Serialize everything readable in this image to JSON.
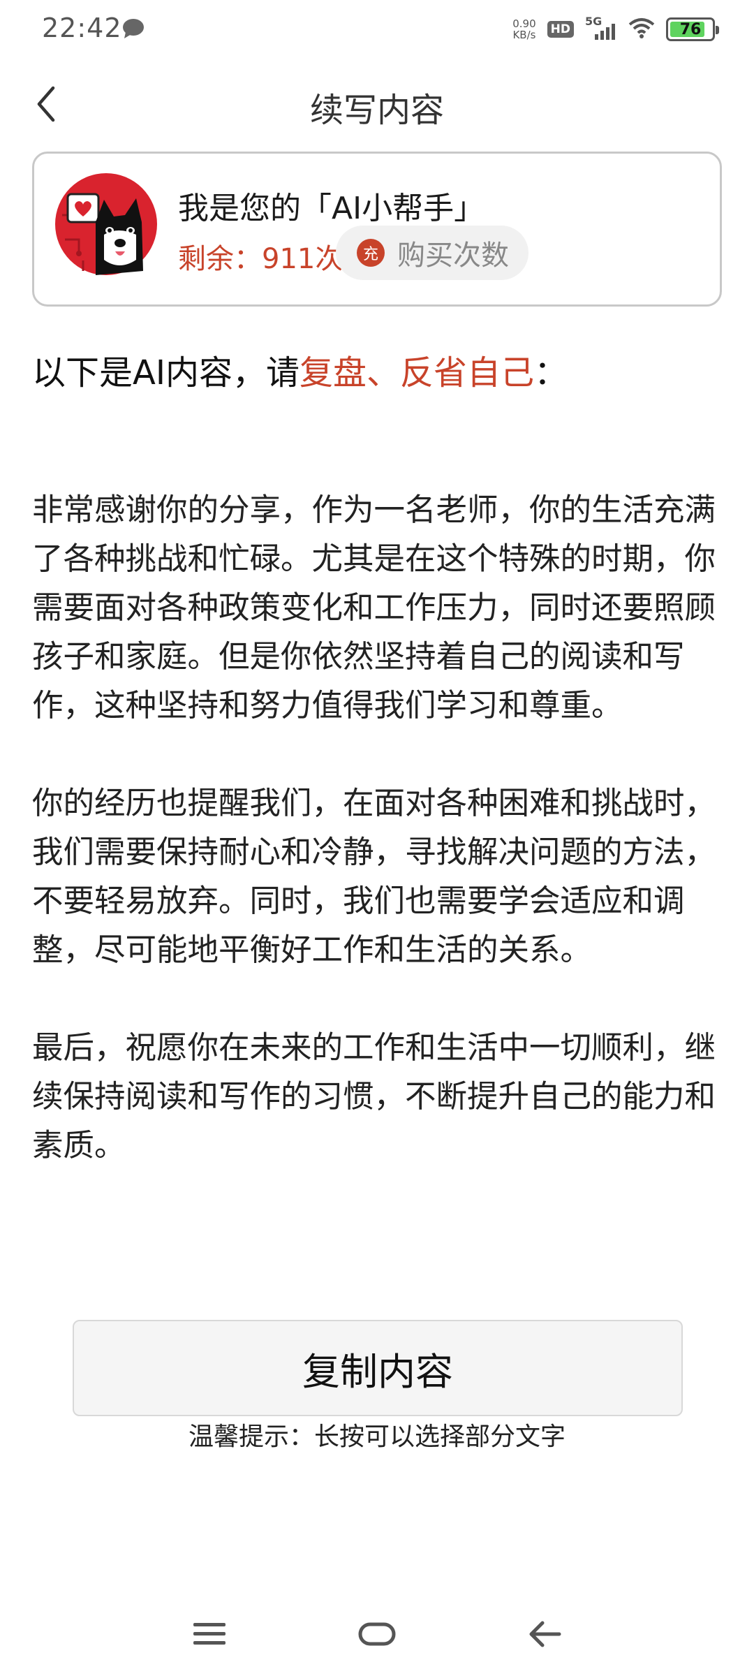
{
  "status_bar": {
    "time": "22:42",
    "net_speed_value": "0.90",
    "net_speed_unit": "KB/s",
    "hd_badge": "HD",
    "network": "5G",
    "battery_level": "76"
  },
  "header": {
    "title": "续写内容"
  },
  "assistant": {
    "name": "我是您的「AI小帮手」",
    "remaining": "剩余：911次",
    "recharge_icon_label": "充",
    "buy_label": "购买次数"
  },
  "prompt": {
    "prefix": "以下是AI内容，请",
    "highlight": "复盘、反省自己",
    "suffix": "："
  },
  "content": {
    "paragraphs": [
      "非常感谢你的分享，作为一名老师，你的生活充满了各种挑战和忙碌。尤其是在这个特殊的时期，你需要面对各种政策变化和工作压力，同时还要照顾孩子和家庭。但是你依然坚持着自己的阅读和写作，这种坚持和努力值得我们学习和尊重。",
      "你的经历也提醒我们，在面对各种困难和挑战时，我们需要保持耐心和冷静，寻找解决问题的方法，不要轻易放弃。同时，我们也需要学会适应和调整，尽可能地平衡好工作和生活的关系。",
      "最后，祝愿你在未来的工作和生活中一切顺利，继续保持阅读和写作的习惯，不断提升自己的能力和素质。"
    ]
  },
  "actions": {
    "copy_label": "复制内容",
    "tip": "温馨提示：长按可以选择部分文字"
  },
  "colors": {
    "accent": "#c8432a",
    "battery": "#5fd35f"
  },
  "icons": [
    "back-arrow-icon",
    "chat-bubble-icon",
    "wifi-icon",
    "signal-icon",
    "battery-icon",
    "recharge-icon",
    "menu-icon",
    "home-icon",
    "back-nav-icon"
  ]
}
